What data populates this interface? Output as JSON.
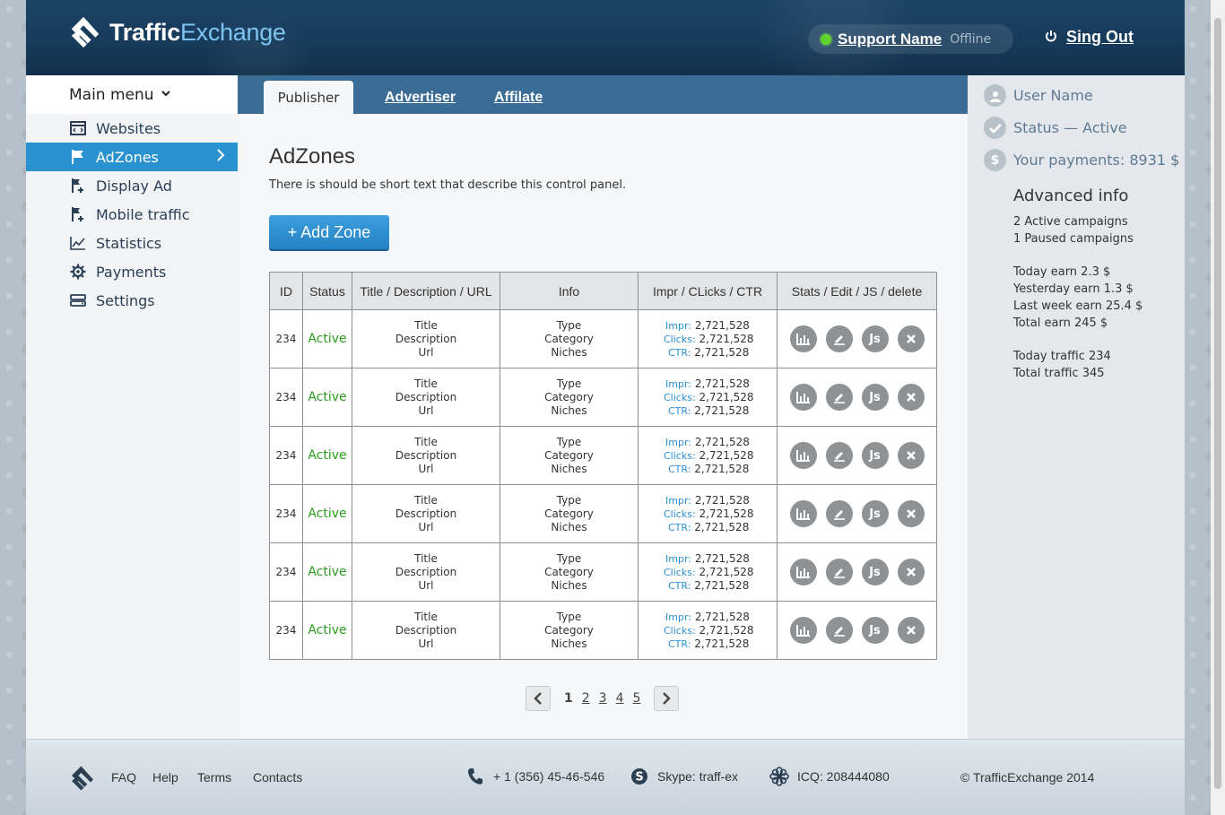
{
  "app": {
    "logo_bold": "Traffic",
    "logo_light": "Exchange",
    "support_name": "Support Name",
    "support_status": "Offline",
    "signout_label": "Sing Out"
  },
  "sidebar": {
    "main_menu": "Main menu",
    "items": [
      {
        "label": "Websites",
        "icon": "websites-icon"
      },
      {
        "label": "AdZones",
        "icon": "flag-icon",
        "active": true
      },
      {
        "label": "Display Ad",
        "icon": "flag-plus-icon"
      },
      {
        "label": "Mobile traffic",
        "icon": "flag-plus-icon"
      },
      {
        "label": "Statistics",
        "icon": "chart-icon"
      },
      {
        "label": "Payments",
        "icon": "gear-icon"
      },
      {
        "label": "Settings",
        "icon": "settings-icon"
      }
    ]
  },
  "tabs": {
    "publisher": "Publisher",
    "advertiser": "Advertiser",
    "affiliate": "Affilate"
  },
  "main": {
    "title": "AdZones",
    "description": "There is should be short text that describe this control panel.",
    "add_button": "+ Add Zone",
    "columns": [
      "ID",
      "Status",
      "Title / Description / URL",
      "Info",
      "Impr / CLicks / CTR",
      "Stats / Edit / JS / delete"
    ],
    "rows": [
      {
        "id": "234",
        "status": "Active",
        "title": "Title",
        "desc": "Description",
        "url": "Url",
        "type": "Type",
        "category": "Category",
        "niches": "Niches",
        "impr": "2,721,528",
        "clicks": "2,721,528",
        "ctr": "2,721,528"
      },
      {
        "id": "234",
        "status": "Active",
        "title": "Title",
        "desc": "Description",
        "url": "Url",
        "type": "Type",
        "category": "Category",
        "niches": "Niches",
        "impr": "2,721,528",
        "clicks": "2,721,528",
        "ctr": "2,721,528"
      },
      {
        "id": "234",
        "status": "Active",
        "title": "Title",
        "desc": "Description",
        "url": "Url",
        "type": "Type",
        "category": "Category",
        "niches": "Niches",
        "impr": "2,721,528",
        "clicks": "2,721,528",
        "ctr": "2,721,528"
      },
      {
        "id": "234",
        "status": "Active",
        "title": "Title",
        "desc": "Description",
        "url": "Url",
        "type": "Type",
        "category": "Category",
        "niches": "Niches",
        "impr": "2,721,528",
        "clicks": "2,721,528",
        "ctr": "2,721,528"
      },
      {
        "id": "234",
        "status": "Active",
        "title": "Title",
        "desc": "Description",
        "url": "Url",
        "type": "Type",
        "category": "Category",
        "niches": "Niches",
        "impr": "2,721,528",
        "clicks": "2,721,528",
        "ctr": "2,721,528"
      },
      {
        "id": "234",
        "status": "Active",
        "title": "Title",
        "desc": "Description",
        "url": "Url",
        "type": "Type",
        "category": "Category",
        "niches": "Niches",
        "impr": "2,721,528",
        "clicks": "2,721,528",
        "ctr": "2,721,528"
      }
    ],
    "metric_labels": {
      "impr": "Impr:",
      "clicks": "Clicks:",
      "ctr": "CTR:"
    },
    "action_js_label": "Js",
    "pages": [
      "1",
      "2",
      "3",
      "4",
      "5"
    ],
    "current_page": "1"
  },
  "right": {
    "user_name": "User Name",
    "status": "Status — Active",
    "payments": "Your payments: 8931 $",
    "advanced_title": "Advanced info",
    "lines": [
      "2 Active campaigns",
      "1 Paused campaigns",
      "Today earn 2.3 $",
      "Yesterday earn 1.3 $",
      "Last week earn 25.4 $",
      "Total earn 245 $",
      "Today traffic 234",
      "Total traffic 345"
    ]
  },
  "footer": {
    "faq": "FAQ",
    "help": "Help",
    "terms": "Terms",
    "contacts": "Contacts",
    "phone": "+ 1 (356) 45-46-546",
    "skype": "Skype: traff-ex",
    "icq": "ICQ: 208444080",
    "copyright": "© TrafficExchange 2014"
  },
  "colors": {
    "header": "#173c5e",
    "accent": "#2a93cf",
    "tabbar": "#3b6c95",
    "status_active": "#2d9a1f",
    "online_dot": "#5fd32c"
  }
}
